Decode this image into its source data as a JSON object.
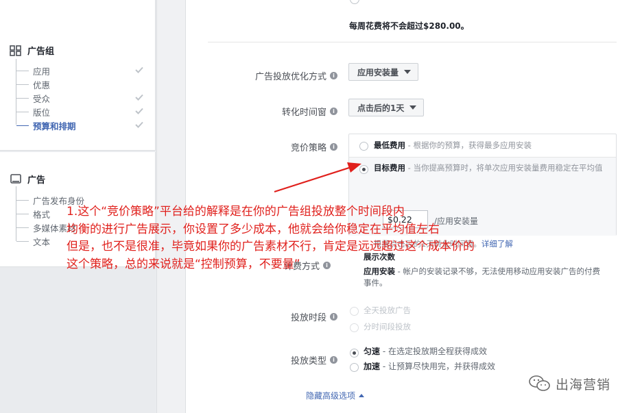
{
  "sidebar": {
    "adset_title": "广告组",
    "adset_items": [
      {
        "label": "应用",
        "checked": true
      },
      {
        "label": "优惠",
        "checked": false
      },
      {
        "label": "受众",
        "checked": true
      },
      {
        "label": "版位",
        "checked": true
      },
      {
        "label": "预算和排期",
        "checked": true,
        "active": true
      }
    ],
    "ad_title": "广告",
    "ad_items": [
      {
        "label": "广告发布身份"
      },
      {
        "label": "格式"
      },
      {
        "label": "多媒体素材"
      },
      {
        "label": "文本"
      }
    ]
  },
  "budget": {
    "weekly_note": "每周花费将不会超过$280.00。"
  },
  "optimization": {
    "label": "广告投放优化方式",
    "value": "应用安装量"
  },
  "conversion_window": {
    "label": "转化时间窗",
    "value": "点击后的1天"
  },
  "bid_strategy": {
    "label": "竞价策略",
    "option1_title": "最低费用",
    "option1_desc": " - 根据你的预算，获得最多应用安装",
    "option2_title": "目标费用",
    "option2_desc": " - 当你提高预算时，将单次应用安装量费用稳定在平均值",
    "cost_value": "$0.22",
    "cost_unit": "/应用安装量",
    "note": "根据点击后的1天转化时间窗。",
    "learn_more": "详细了解"
  },
  "charge": {
    "label": "计费方式",
    "line1": "展示次数",
    "line2_title": "应用安装",
    "line2_desc": " - 帐户的安装记录不够，无法使用移动应用安装广告的付费",
    "line2_cont": "事件。"
  },
  "schedule": {
    "label": "投放时段",
    "option1": "全天投放广告",
    "option2": "分时间段投放"
  },
  "delivery": {
    "label": "投放类型",
    "option1_title": "匀速",
    "option1_desc": " - 在选定投放期全程获得成效",
    "option2_title": "加速",
    "option2_desc": " - 让预算尽快用完，并获得成效"
  },
  "hidden_advanced": "隐藏高级选项",
  "annotation": {
    "line1": "1.这个“竞价策略”平台给的解释是在你的广告组投放整个时间段内",
    "line2": "均衡的进行广告展示，你设置了多少成本，他就会给你稳定在平均值左右",
    "line3": "但是，也不是很准，毕竟如果你的广告素材不行，肯定是远远超过这个成本价的",
    "line4": "这个策略，总的来说就是“控制预算，不要量”",
    "color": "#e0201c"
  },
  "watermark": "出海营销"
}
